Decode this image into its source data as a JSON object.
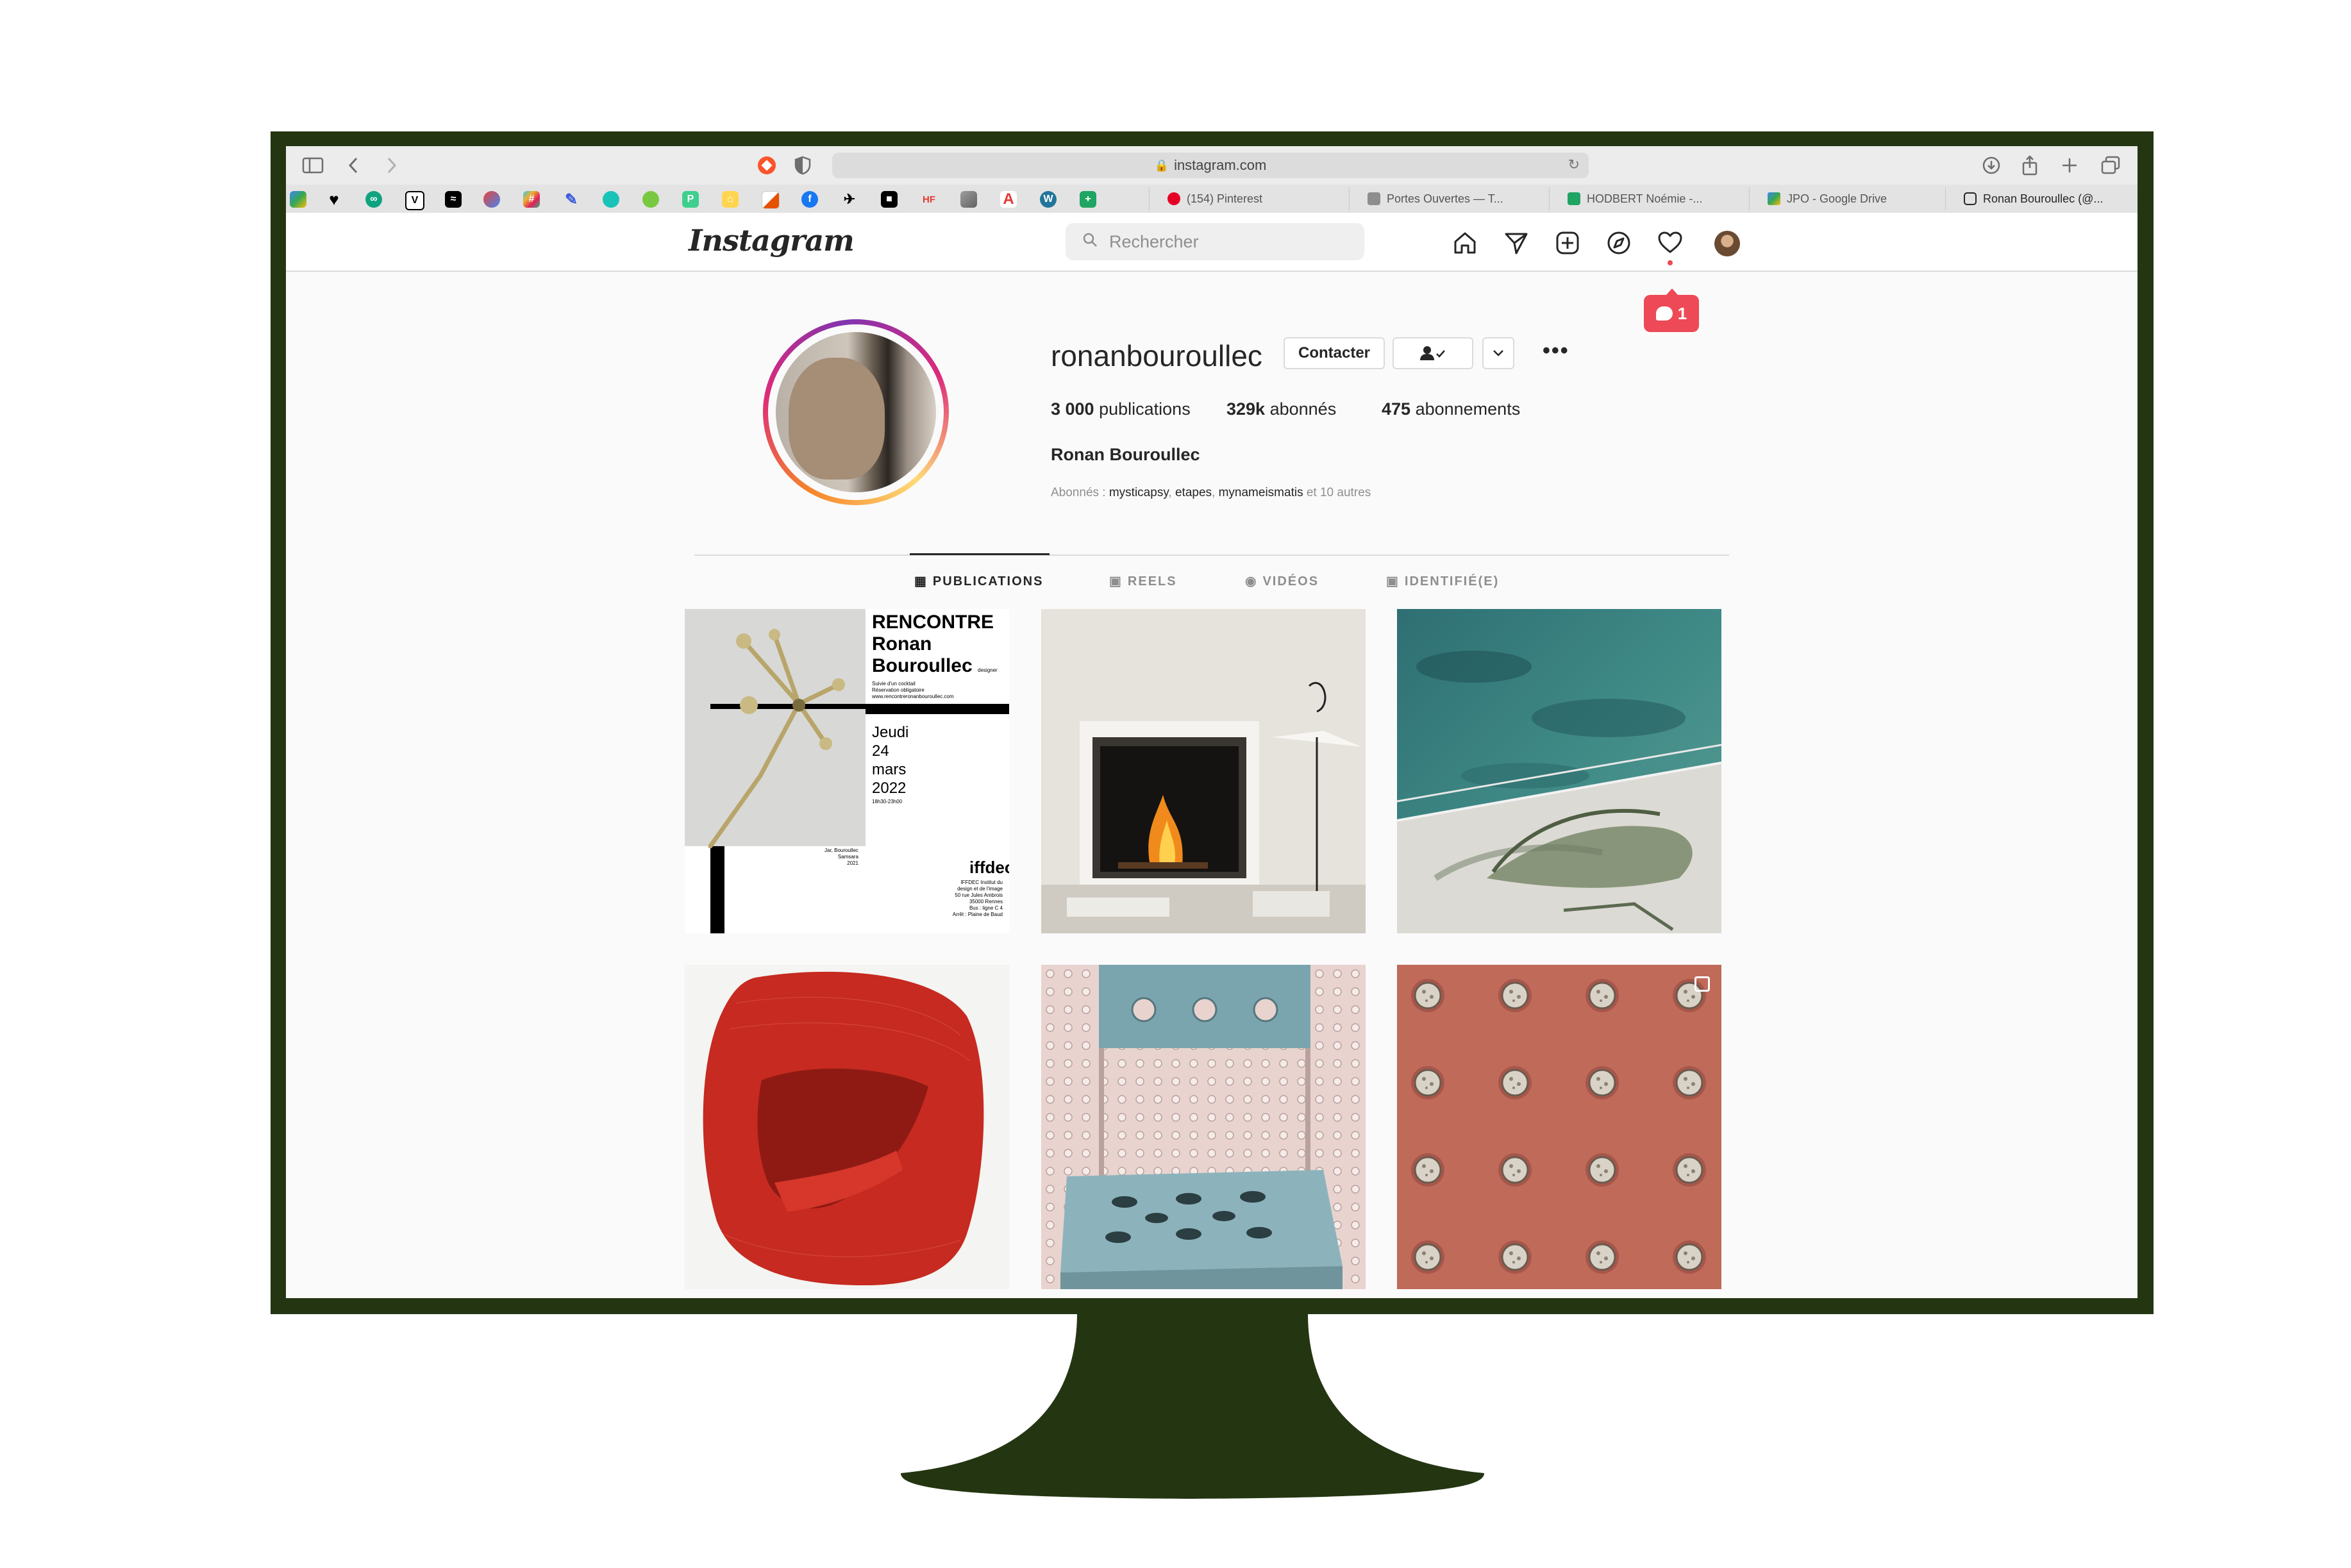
{
  "browser": {
    "url": "instagram.com",
    "bookmark_tabs": [
      {
        "label": "(154) Pinterest",
        "color": "#e60023"
      },
      {
        "label": "Portes Ouvertes — T...",
        "color": "#8e8e8e"
      },
      {
        "label": "HODBERT Noémie -...",
        "color": "#1fa463"
      },
      {
        "label": "JPO - Google Drive",
        "color": "#f4b400"
      },
      {
        "label": "Ronan Bouroullec (@...",
        "color": "#262626"
      }
    ]
  },
  "instagram": {
    "logo": "Instagram",
    "search_placeholder": "Rechercher",
    "notification_count": "1",
    "profile": {
      "username": "ronanbouroullec",
      "contact_label": "Contacter",
      "posts_count": "3 000",
      "posts_label": "publications",
      "followers_count": "329k",
      "followers_label": "abonnés",
      "following_count": "475",
      "following_label": "abonnements",
      "full_name": "Ronan Bouroullec",
      "followed_by_prefix": "Abonnés :",
      "followed_by_1": "mysticapsy",
      "followed_by_2": "etapes",
      "followed_by_3": "mynameismatis",
      "followed_by_suffix": "et 10 autres"
    },
    "tabs": [
      {
        "label": "PUBLICATIONS",
        "active": true
      },
      {
        "label": "REELS",
        "active": false
      },
      {
        "label": "VIDÉOS",
        "active": false
      },
      {
        "label": "IDENTIFIÉ(E)",
        "active": false
      }
    ],
    "poster": {
      "title_1": "RENCONTRE",
      "title_2": "Ronan",
      "title_3": "Bouroullec",
      "title_tag": "designer",
      "sub_1": "Suivie d'un cocktail",
      "sub_2": "Réservation obligatoire",
      "sub_3": "www.rencontreronanbouroullec.com",
      "date_1": "Jeudi",
      "date_2": "24",
      "date_3": "mars",
      "date_4": "2022",
      "time": "18h30-23h00",
      "credit_1": "Jar, Bouroullec",
      "credit_2": "Samsara",
      "credit_3": "2021",
      "logo": "iffdec",
      "addr_1": "IFFDEC Institut du",
      "addr_2": "design et de l'image",
      "addr_3": "50 rue Jules Ambrois",
      "addr_4": "35000 Rennes",
      "addr_5": "Bus : ligne C 4",
      "addr_6": "Arrêt : Plaine de Baud"
    }
  }
}
